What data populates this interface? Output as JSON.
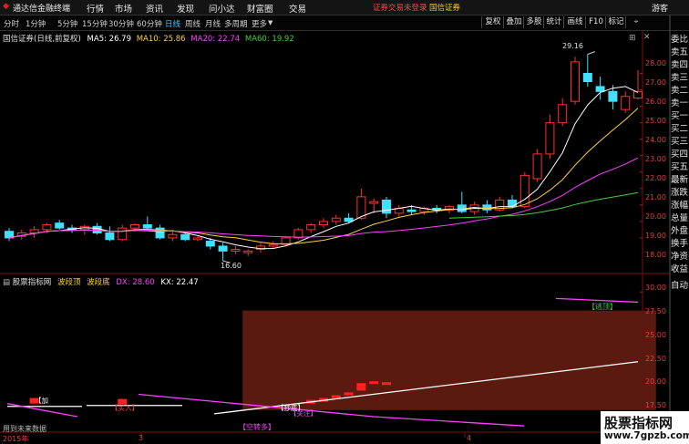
{
  "app": {
    "title": "通达信金融终端",
    "logo_glyph": "◆"
  },
  "menu": [
    {
      "label": "行情"
    },
    {
      "label": "市场"
    },
    {
      "label": "资讯"
    },
    {
      "label": "发现"
    },
    {
      "label": "问小达"
    },
    {
      "label": "财富圈"
    },
    {
      "label": "交易"
    }
  ],
  "account": {
    "status": "证券交易未登录",
    "broker": "国信证券",
    "guest": "游客",
    "status_color": "#ff4040",
    "broker_color": "#ffd000"
  },
  "toolbar": {
    "periods": [
      "分时",
      "1分钟",
      "5分钟",
      "15分钟",
      "30分钟",
      "60分钟",
      "日线",
      "周线",
      "月线",
      "多周期",
      "更多"
    ],
    "active_period": "日线",
    "right_buttons": [
      "复权",
      "叠加",
      "多股",
      "统计",
      "画线",
      "F10",
      "标记"
    ]
  },
  "main_chart": {
    "stock": "国信证券(日线,前复权)",
    "ma": [
      {
        "label": "MA5: 26.79",
        "color": "#ffffff"
      },
      {
        "label": "MA10: 25.86",
        "color": "#ffd040"
      },
      {
        "label": "MA20: 22.74",
        "color": "#ff40ff"
      },
      {
        "label": "MA60: 19.92",
        "color": "#40d040"
      }
    ],
    "high_label": "29.16",
    "low_label": "16.60",
    "y_ticks": [
      "28.00",
      "27.00",
      "26.00",
      "25.00",
      "24.00",
      "23.00",
      "22.00",
      "21.00",
      "20.00",
      "19.00",
      "18.00"
    ]
  },
  "sub_chart": {
    "name": "股票指标网",
    "line1": "波段顶",
    "line2": "波段底",
    "dx_label": "DX: 28.60",
    "kx_label": "KX: 22.47",
    "dx_color": "#ff40ff",
    "kx_color": "#ffffff",
    "y_ticks": [
      "30.00",
      "27.50",
      "25.00",
      "22.50",
      "20.00",
      "17.50"
    ],
    "annotations": {
      "top": "【逃顶】",
      "buy1": "【加",
      "buy2": "【买入】",
      "low": "【抄底】",
      "warn": "【空转多】",
      "extra": "【关注】"
    }
  },
  "status": {
    "hint": "用到未来数据",
    "year": "2015年",
    "month_3": "3",
    "month_4": "4"
  },
  "side_panel": {
    "items": [
      "委比",
      "卖五",
      "卖四",
      "卖三",
      "卖二",
      "卖一",
      "买一",
      "买二",
      "买三",
      "买四",
      "买五",
      "最新",
      "涨跌",
      "涨幅",
      "总量",
      "外盘",
      "换手",
      "净资",
      "收益"
    ],
    "bottom": "自动"
  },
  "watermark": {
    "title": "股票指标网",
    "url": "www.7gpzb.com"
  },
  "chart_data": {
    "type": "candlestick",
    "title": "国信证券(日线,前复权)",
    "ylim": [
      16.5,
      29.8
    ],
    "candles": [
      {
        "o": 18.4,
        "h": 18.6,
        "l": 17.8,
        "c": 18.0
      },
      {
        "o": 18.1,
        "h": 18.5,
        "l": 17.9,
        "c": 18.3
      },
      {
        "o": 18.3,
        "h": 18.7,
        "l": 18.0,
        "c": 18.5
      },
      {
        "o": 18.5,
        "h": 18.9,
        "l": 18.3,
        "c": 18.8
      },
      {
        "o": 18.9,
        "h": 19.1,
        "l": 18.5,
        "c": 18.6
      },
      {
        "o": 18.6,
        "h": 18.8,
        "l": 18.3,
        "c": 18.5
      },
      {
        "o": 18.5,
        "h": 18.8,
        "l": 18.2,
        "c": 18.7
      },
      {
        "o": 18.7,
        "h": 18.9,
        "l": 18.2,
        "c": 18.3
      },
      {
        "o": 18.3,
        "h": 18.7,
        "l": 17.8,
        "c": 17.9
      },
      {
        "o": 17.9,
        "h": 18.8,
        "l": 17.8,
        "c": 18.6
      },
      {
        "o": 18.6,
        "h": 18.9,
        "l": 18.4,
        "c": 18.8
      },
      {
        "o": 18.8,
        "h": 19.3,
        "l": 18.5,
        "c": 18.6
      },
      {
        "o": 18.6,
        "h": 18.8,
        "l": 17.9,
        "c": 18.0
      },
      {
        "o": 18.0,
        "h": 18.4,
        "l": 17.8,
        "c": 18.2
      },
      {
        "o": 18.2,
        "h": 18.3,
        "l": 17.8,
        "c": 17.9
      },
      {
        "o": 17.9,
        "h": 18.1,
        "l": 17.8,
        "c": 18.0
      },
      {
        "o": 17.8,
        "h": 18.0,
        "l": 17.3,
        "c": 17.5
      },
      {
        "o": 17.5,
        "h": 17.7,
        "l": 16.6,
        "c": 17.2
      },
      {
        "o": 17.2,
        "h": 17.5,
        "l": 17.0,
        "c": 17.3
      },
      {
        "o": 17.1,
        "h": 17.3,
        "l": 16.9,
        "c": 17.2
      },
      {
        "o": 17.3,
        "h": 17.7,
        "l": 17.1,
        "c": 17.5
      },
      {
        "o": 17.5,
        "h": 17.8,
        "l": 17.4,
        "c": 17.6
      },
      {
        "o": 17.6,
        "h": 18.1,
        "l": 17.5,
        "c": 18.0
      },
      {
        "o": 18.0,
        "h": 18.6,
        "l": 17.9,
        "c": 18.5
      },
      {
        "o": 18.5,
        "h": 18.9,
        "l": 18.3,
        "c": 18.8
      },
      {
        "o": 18.8,
        "h": 19.2,
        "l": 18.6,
        "c": 19.0
      },
      {
        "o": 19.0,
        "h": 19.4,
        "l": 18.8,
        "c": 19.2
      },
      {
        "o": 19.2,
        "h": 19.5,
        "l": 18.9,
        "c": 19.0
      },
      {
        "o": 19.2,
        "h": 21.0,
        "l": 19.1,
        "c": 20.5
      },
      {
        "o": 20.1,
        "h": 20.4,
        "l": 19.5,
        "c": 20.2
      },
      {
        "o": 20.3,
        "h": 20.5,
        "l": 19.2,
        "c": 19.5
      },
      {
        "o": 19.5,
        "h": 20.0,
        "l": 19.3,
        "c": 19.8
      },
      {
        "o": 19.7,
        "h": 20.0,
        "l": 19.4,
        "c": 19.6
      },
      {
        "o": 19.6,
        "h": 19.9,
        "l": 19.4,
        "c": 19.8
      },
      {
        "o": 19.8,
        "h": 20.0,
        "l": 19.5,
        "c": 19.7
      },
      {
        "o": 19.7,
        "h": 20.0,
        "l": 19.5,
        "c": 19.9
      },
      {
        "o": 20.0,
        "h": 20.8,
        "l": 19.5,
        "c": 19.6
      },
      {
        "o": 19.6,
        "h": 20.2,
        "l": 19.4,
        "c": 20.0
      },
      {
        "o": 20.0,
        "h": 20.3,
        "l": 19.5,
        "c": 19.7
      },
      {
        "o": 19.7,
        "h": 20.5,
        "l": 19.6,
        "c": 20.3
      },
      {
        "o": 20.3,
        "h": 20.6,
        "l": 19.8,
        "c": 19.9
      },
      {
        "o": 19.9,
        "h": 22.0,
        "l": 19.8,
        "c": 21.8
      },
      {
        "o": 21.6,
        "h": 23.4,
        "l": 21.4,
        "c": 23.1
      },
      {
        "o": 23.1,
        "h": 25.5,
        "l": 22.8,
        "c": 25.0
      },
      {
        "o": 25.0,
        "h": 26.5,
        "l": 24.8,
        "c": 26.1
      },
      {
        "o": 26.3,
        "h": 29.0,
        "l": 26.1,
        "c": 28.7
      },
      {
        "o": 28.0,
        "h": 29.16,
        "l": 27.2,
        "c": 27.5
      },
      {
        "o": 27.2,
        "h": 27.8,
        "l": 26.4,
        "c": 26.9
      },
      {
        "o": 26.9,
        "h": 27.3,
        "l": 25.8,
        "c": 26.3
      },
      {
        "o": 25.8,
        "h": 26.9,
        "l": 25.6,
        "c": 26.6
      },
      {
        "o": 26.5,
        "h": 28.2,
        "l": 26.4,
        "c": 26.9
      }
    ],
    "ma_lines": [
      {
        "name": "MA5",
        "color": "#ffffff"
      },
      {
        "name": "MA10",
        "color": "#ffd040"
      },
      {
        "name": "MA20",
        "color": "#ff40ff"
      },
      {
        "name": "MA60",
        "color": "#40d040"
      }
    ],
    "sub": {
      "ylim": [
        16.5,
        31.0
      ],
      "kx": [
        {
          "i": 1,
          "v": 17.6
        },
        {
          "i": 14,
          "v": 17.7
        },
        {
          "i": 22,
          "v": 17.2
        },
        {
          "i": 36,
          "v": 19.8
        },
        {
          "i": 50,
          "v": 22.5
        }
      ],
      "dx": [
        {
          "i": 45,
          "v": 29.0
        },
        {
          "i": 50,
          "v": 28.6
        }
      ],
      "zone": {
        "start": 19,
        "end": 51,
        "top": 28.0
      }
    }
  }
}
